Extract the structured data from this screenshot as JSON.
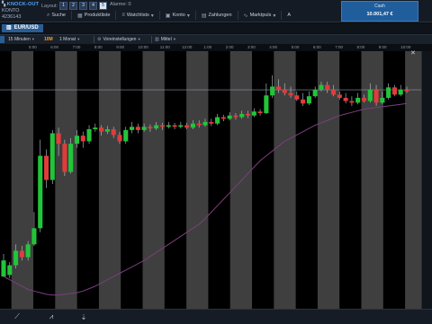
{
  "brand": {
    "product": "KNOCK-OUT",
    "account_label": "KONTO",
    "account_number": "4236143"
  },
  "layout": {
    "label": "Layout:",
    "buttons": [
      "1",
      "2",
      "3",
      "4",
      "5"
    ],
    "active": "5"
  },
  "alarme": {
    "label": "Alarme:",
    "count": "0"
  },
  "menu": [
    {
      "label": "Suche",
      "icon": "search-icon"
    },
    {
      "label": "Produktliste",
      "icon": "grid-icon"
    },
    {
      "label": "Watchlists",
      "icon": "list-icon"
    },
    {
      "label": "Konto",
      "icon": "wallet-icon"
    },
    {
      "label": "Zahlungen",
      "icon": "payment-icon"
    },
    {
      "label": "Marktpuls",
      "icon": "pulse-icon"
    },
    {
      "label": "A",
      "icon": "text-icon"
    }
  ],
  "cash": {
    "label": "Cash",
    "value": "10.001,47 €"
  },
  "chart_tab": {
    "label": "EUR/USD"
  },
  "toolbar": {
    "interval": "15 Minuten",
    "flag": "10M",
    "period": "1 Monat",
    "presets": "Voreinstellungen",
    "price_type": "Mittel"
  },
  "time_labels": [
    "5:00",
    "6:00",
    "7:00",
    "8:00",
    "9:00",
    "10:00",
    "11:00",
    "12:00",
    "1:00",
    "2:00",
    "3:00",
    "4:00",
    "5:00",
    "6:00",
    "7:00",
    "8:00",
    "9:00",
    "10:00"
  ],
  "colors": {
    "up": "#22c53a",
    "down": "#e23b3b",
    "ma": "#7a3f7e",
    "shade": "#4a4a4a",
    "accent": "#1f5d9c"
  },
  "chart_data": {
    "type": "candlestick",
    "series": [
      {
        "candles": [
          [
            0,
            20,
            2,
            28
          ],
          [
            2,
            14,
            -2,
            18
          ],
          [
            14,
            32,
            10,
            40
          ],
          [
            32,
            24,
            20,
            38
          ],
          [
            24,
            40,
            20,
            44
          ],
          [
            40,
            60,
            38,
            80
          ],
          [
            60,
            150,
            55,
            170
          ],
          [
            150,
            120,
            110,
            158
          ],
          [
            120,
            178,
            115,
            182
          ],
          [
            178,
            165,
            150,
            185
          ],
          [
            165,
            130,
            125,
            170
          ],
          [
            130,
            165,
            128,
            172
          ],
          [
            165,
            175,
            160,
            182
          ],
          [
            175,
            168,
            160,
            180
          ],
          [
            168,
            183,
            165,
            188
          ],
          [
            183,
            185,
            180,
            190
          ],
          [
            185,
            180,
            175,
            188
          ],
          [
            180,
            183,
            177,
            187
          ],
          [
            183,
            176,
            172,
            186
          ],
          [
            176,
            168,
            165,
            180
          ],
          [
            168,
            182,
            165,
            186
          ],
          [
            182,
            186,
            178,
            192
          ],
          [
            186,
            182,
            178,
            190
          ],
          [
            182,
            186,
            180,
            190
          ],
          [
            186,
            184,
            180,
            189
          ],
          [
            184,
            188,
            182,
            192
          ],
          [
            188,
            186,
            182,
            191
          ],
          [
            186,
            188,
            184,
            192
          ],
          [
            188,
            186,
            183,
            191
          ],
          [
            186,
            188,
            184,
            192
          ],
          [
            188,
            185,
            183,
            191
          ],
          [
            185,
            190,
            183,
            194
          ],
          [
            190,
            188,
            185,
            194
          ],
          [
            188,
            192,
            186,
            196
          ],
          [
            192,
            190,
            187,
            196
          ],
          [
            190,
            198,
            188,
            202
          ],
          [
            198,
            196,
            193,
            201
          ],
          [
            196,
            200,
            194,
            204
          ],
          [
            200,
            198,
            195,
            203
          ],
          [
            198,
            202,
            196,
            206
          ],
          [
            202,
            200,
            197,
            206
          ],
          [
            200,
            205,
            198,
            209
          ],
          [
            205,
            203,
            200,
            208
          ],
          [
            203,
            225,
            202,
            240
          ],
          [
            225,
            236,
            222,
            250
          ],
          [
            236,
            232,
            228,
            245
          ],
          [
            232,
            228,
            225,
            240
          ],
          [
            228,
            225,
            222,
            236
          ],
          [
            225,
            220,
            218,
            230
          ],
          [
            220,
            215,
            212,
            228
          ],
          [
            215,
            224,
            213,
            230
          ],
          [
            224,
            232,
            222,
            236
          ],
          [
            232,
            238,
            230,
            242
          ],
          [
            238,
            232,
            228,
            242
          ],
          [
            232,
            226,
            224,
            238
          ],
          [
            226,
            222,
            220,
            230
          ],
          [
            222,
            218,
            215,
            228
          ],
          [
            218,
            216,
            212,
            224
          ],
          [
            216,
            222,
            214,
            228
          ],
          [
            222,
            218,
            216,
            226
          ],
          [
            218,
            232,
            216,
            240
          ],
          [
            232,
            216,
            212,
            238
          ],
          [
            216,
            222,
            214,
            230
          ],
          [
            222,
            235,
            220,
            240
          ],
          [
            235,
            226,
            224,
            238
          ],
          [
            226,
            232,
            224,
            238
          ],
          [
            232,
            230,
            228,
            236
          ]
        ]
      }
    ],
    "moving_average": [
      0,
      -4,
      -8,
      -12,
      -16,
      -18,
      -20,
      -22,
      -23,
      -23,
      -22,
      -21,
      -20,
      -18,
      -15,
      -12,
      -8,
      -4,
      0,
      4,
      8,
      12,
      16,
      20,
      25,
      30,
      35,
      40,
      45,
      50,
      55,
      60,
      65,
      72,
      80,
      88,
      96,
      104,
      112,
      120,
      128,
      136,
      144,
      150,
      156,
      162,
      168,
      172,
      176,
      180,
      184,
      188,
      191,
      194,
      197,
      200,
      202,
      204,
      206,
      208,
      209,
      210,
      211,
      212,
      213,
      214,
      215
    ],
    "y_range": [
      -40,
      280
    ]
  }
}
